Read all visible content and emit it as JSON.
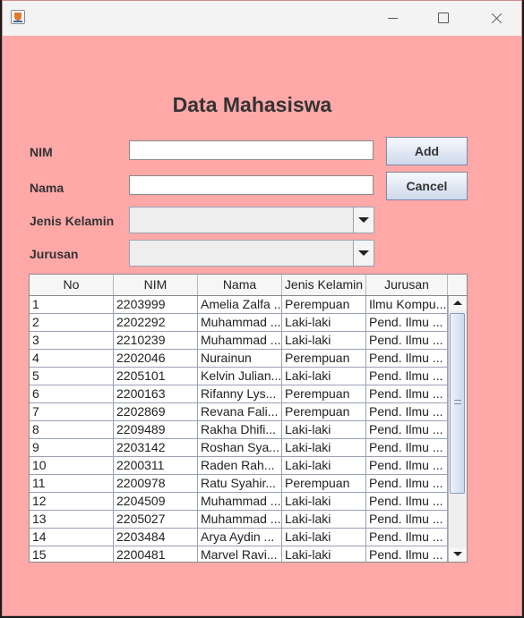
{
  "window": {
    "controls": [
      "minimize-icon",
      "maximize-icon",
      "close-icon"
    ]
  },
  "form": {
    "title": "Data Mahasiswa",
    "nim_label": "NIM",
    "nim_value": "",
    "nama_label": "Nama",
    "nama_value": "",
    "jenis_kelamin_label": "Jenis Kelamin",
    "jenis_kelamin_value": "",
    "jurusan_label": "Jurusan",
    "jurusan_value": "",
    "add_label": "Add",
    "cancel_label": "Cancel"
  },
  "colors": {
    "background": "#ffa8a8",
    "titlebar": "#f3f3f3",
    "button": "#dbe3f1"
  },
  "table": {
    "columns": [
      "No",
      "NIM",
      "Nama",
      "Jenis Kelamin",
      "Jurusan"
    ],
    "rows": [
      [
        "1",
        "2203999",
        "Amelia Zalfa ...",
        "Perempuan",
        "Ilmu Kompu..."
      ],
      [
        "2",
        "2202292",
        "Muhammad ...",
        "Laki-laki",
        "Pend. Ilmu ..."
      ],
      [
        "3",
        "2210239",
        "Muhammad ...",
        "Laki-laki",
        "Pend. Ilmu ..."
      ],
      [
        "4",
        "2202046",
        "Nurainun",
        "Perempuan",
        "Pend. Ilmu ..."
      ],
      [
        "5",
        "2205101",
        "Kelvin Julian...",
        "Laki-laki",
        "Pend. Ilmu ..."
      ],
      [
        "6",
        "2200163",
        "Rifanny Lys...",
        "Perempuan",
        "Pend. Ilmu ..."
      ],
      [
        "7",
        "2202869",
        "Revana Fali...",
        "Perempuan",
        "Pend. Ilmu ..."
      ],
      [
        "8",
        "2209489",
        "Rakha Dhifi...",
        "Laki-laki",
        "Pend. Ilmu ..."
      ],
      [
        "9",
        "2203142",
        "Roshan Sya...",
        "Laki-laki",
        "Pend. Ilmu ..."
      ],
      [
        "10",
        "2200311",
        "Raden Rah...",
        "Laki-laki",
        "Pend. Ilmu ..."
      ],
      [
        "11",
        "2200978",
        "Ratu Syahir...",
        "Perempuan",
        "Pend. Ilmu ..."
      ],
      [
        "12",
        "2204509",
        "Muhammad ...",
        "Laki-laki",
        "Pend. Ilmu ..."
      ],
      [
        "13",
        "2205027",
        "Muhammad ...",
        "Laki-laki",
        "Pend. Ilmu ..."
      ],
      [
        "14",
        "2203484",
        "Arya Aydin ...",
        "Laki-laki",
        "Pend. Ilmu ..."
      ],
      [
        "15",
        "2200481",
        "Marvel Ravi...",
        "Laki-laki",
        "Pend. Ilmu ..."
      ]
    ]
  }
}
